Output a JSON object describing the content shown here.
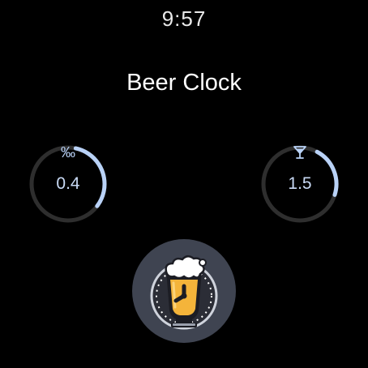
{
  "status": {
    "time": "9:57"
  },
  "app": {
    "title": "Beer Clock"
  },
  "complications": [
    {
      "icon": "per-mille-icon",
      "symbol": "‰",
      "value": "0.4",
      "progress": 0.32
    },
    {
      "icon": "cocktail-glass-icon",
      "value": "1.5",
      "progress": 0.22
    }
  ],
  "colors": {
    "background": "#000000",
    "accent": "#b9d2f7",
    "ring_track": "#2e2e2e",
    "button_bg": "#3f4451",
    "beer": "#f4b43a",
    "foam": "#ffffff"
  },
  "launcher": {
    "icon": "beer-glass-clock-icon"
  }
}
